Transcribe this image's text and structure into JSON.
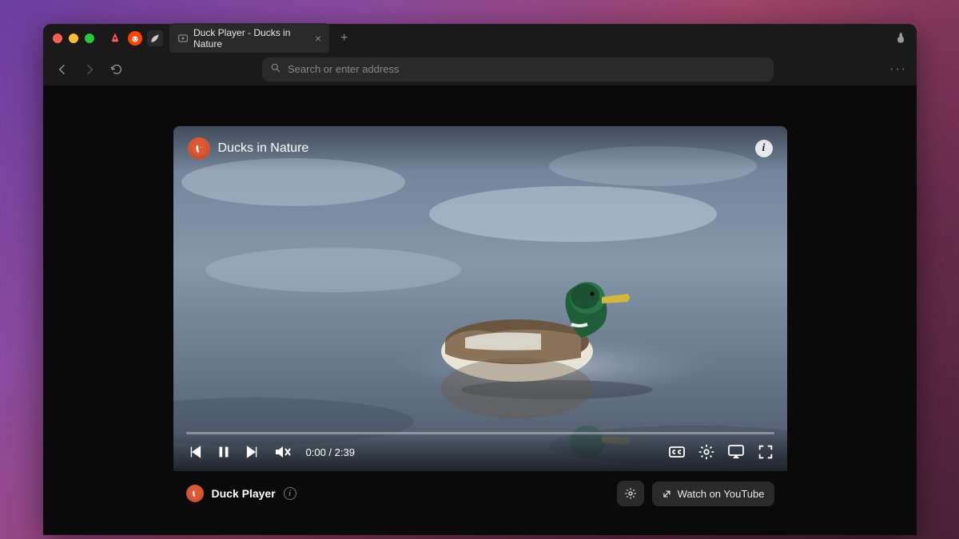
{
  "browser": {
    "tab_title": "Duck Player - Ducks in Nature",
    "address_placeholder": "Search or enter address"
  },
  "player": {
    "video_title": "Ducks in Nature",
    "current_time": "0:00",
    "separator": " / ",
    "duration": "2:39",
    "footer_label": "Duck Player",
    "watch_external_label": "Watch on YouTube"
  },
  "icons": {
    "airbnb": "◬",
    "reddit": "●",
    "misc": "◪",
    "play_tab": "▷",
    "fire": "🔥",
    "search": "🔍",
    "duck": "🦆"
  }
}
